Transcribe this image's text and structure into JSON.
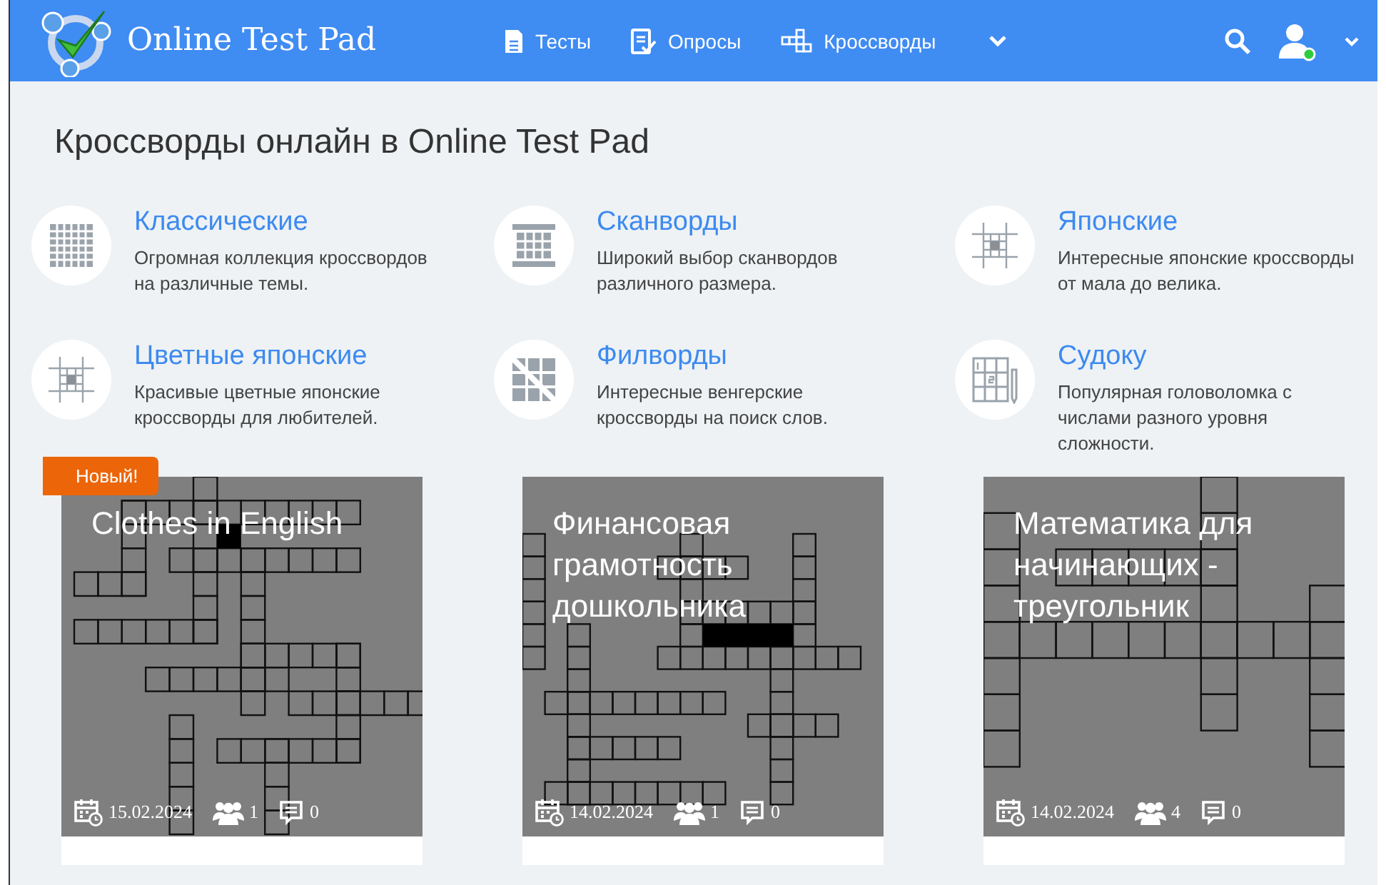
{
  "header": {
    "logo_text": "Online Test Pad",
    "nav": [
      {
        "label": "Тесты"
      },
      {
        "label": "Опросы"
      },
      {
        "label": "Кроссворды"
      }
    ]
  },
  "page_title": "Кроссворды онлайн в Online Test Pad",
  "categories": [
    {
      "title": "Классические",
      "description": "Огромная коллекция кроссвордов на различные темы."
    },
    {
      "title": "Сканворды",
      "description": "Широкий выбор сканвордов различного размера."
    },
    {
      "title": "Японские",
      "description": "Интересные японские кроссворды от мала до велика."
    },
    {
      "title": "Цветные японские",
      "description": "Красивые цветные японские кроссворды для любителей."
    },
    {
      "title": "Филворды",
      "description": "Интересные венгерские кроссворды на поиск слов."
    },
    {
      "title": "Судоку",
      "description": "Популярная головоломка с числами разного уровня сложности."
    }
  ],
  "cards": [
    {
      "title": "Clothes in English",
      "badge": "Новый!",
      "date": "15.02.2024",
      "participants": "1",
      "comments": "0"
    },
    {
      "title": "Финансовая грамотность дошкольника",
      "date": "14.02.2024",
      "participants": "1",
      "comments": "0"
    },
    {
      "title": "Математика для начинающих - треугольник",
      "date": "14.02.2024",
      "participants": "4",
      "comments": "0"
    }
  ]
}
